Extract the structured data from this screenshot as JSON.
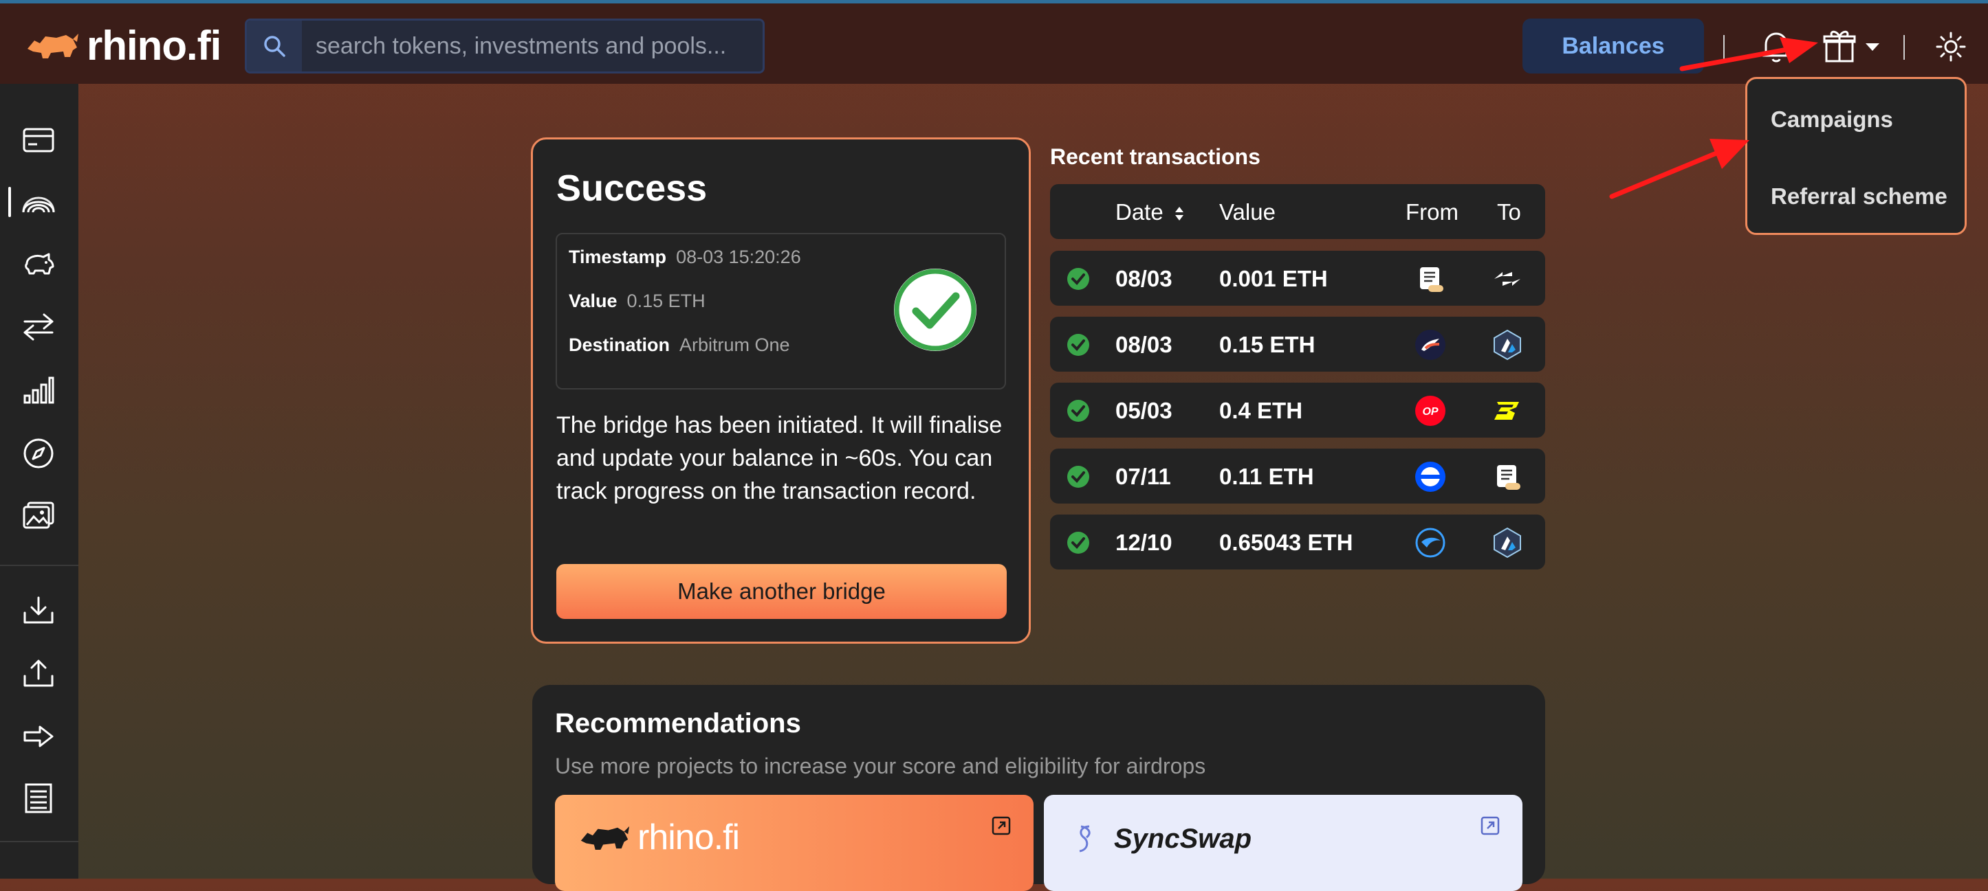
{
  "header": {
    "brand": "rhino.fi",
    "search_placeholder": "search tokens, investments and pools...",
    "balances_label": "Balances",
    "icons": [
      "search-icon",
      "bell-icon",
      "gift-icon",
      "chevron-down-icon",
      "sun-icon"
    ]
  },
  "sidebar": {
    "items": [
      "card-icon",
      "bridge-icon",
      "piggy-bank-icon",
      "swap-icon",
      "chart-icon",
      "compass-icon",
      "gallery-icon",
      "download-icon",
      "upload-icon",
      "arrow-right-icon",
      "receipt-icon"
    ]
  },
  "gift_menu": {
    "items": [
      {
        "label": "Campaigns"
      },
      {
        "label": "Referral scheme"
      }
    ]
  },
  "success": {
    "title": "Success",
    "timestamp_label": "Timestamp",
    "timestamp_value": "08-03 15:20:26",
    "value_label": "Value",
    "value_value": "0.15 ETH",
    "destination_label": "Destination",
    "destination_value": "Arbitrum One",
    "message": "The bridge has been initiated. It will finalise and update your balance in ~60s. You can track progress on the transaction record.",
    "button_label": "Make another bridge"
  },
  "recent": {
    "title": "Recent transactions",
    "headers": {
      "date": "Date",
      "value": "Value",
      "from": "From",
      "to": "To"
    },
    "rows": [
      {
        "date": "08/03",
        "value": "0.001 ETH",
        "from": "scroll-icon",
        "to": "zksync-icon"
      },
      {
        "date": "08/03",
        "value": "0.15 ETH",
        "from": "starknet-icon",
        "to": "arbitrum-icon"
      },
      {
        "date": "05/03",
        "value": "0.4 ETH",
        "from": "optimism-icon",
        "to": "blast-icon"
      },
      {
        "date": "07/11",
        "value": "0.11 ETH",
        "from": "base-icon",
        "to": "scroll-icon"
      },
      {
        "date": "12/10",
        "value": "0.65043 ETH",
        "from": "taiko-icon",
        "to": "arbitrum-icon"
      }
    ],
    "optimism_badge": "OP"
  },
  "recommendations": {
    "title": "Recommendations",
    "subtitle": "Use more projects to increase your score and eligibility for airdrops",
    "projects": [
      {
        "name": "rhino.fi",
        "color": "#ff9a5f"
      },
      {
        "name": "SyncSwap",
        "color": "#e9ecfb"
      }
    ]
  },
  "colors": {
    "accent_orange": "#f08a5d",
    "balances_text": "#7fb2f5",
    "success_green": "#3aa64a",
    "annotation_red": "#ff1a1a"
  }
}
